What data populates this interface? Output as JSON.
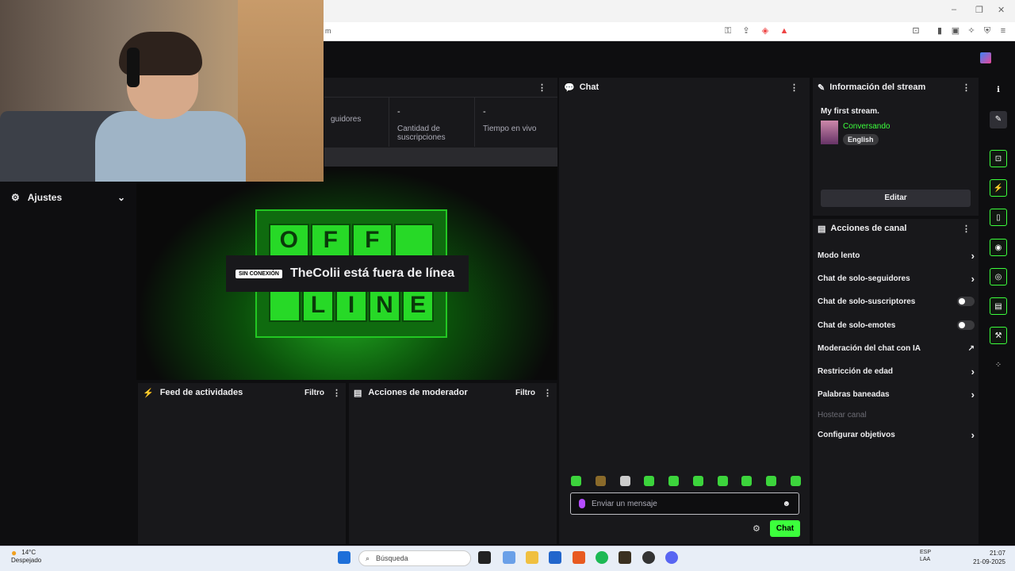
{
  "browser": {
    "url": "m",
    "window_controls": [
      "–",
      "❐",
      "✕"
    ]
  },
  "settings": {
    "label": "Ajustes"
  },
  "stats": {
    "items": [
      {
        "value": "",
        "label": "guidores"
      },
      {
        "value": "-",
        "label": "Cantidad de suscripciones"
      },
      {
        "value": "-",
        "label": "Tiempo en vivo"
      }
    ]
  },
  "player": {
    "offline_badge": "SIN CONEXIÓN",
    "offline_text": "TheColii está fuera de línea",
    "sign_top": [
      "O",
      "F",
      "F",
      ""
    ],
    "sign_bottom": [
      "",
      "L",
      "I",
      "N",
      "E"
    ]
  },
  "feed": {
    "title": "Feed de actividades",
    "filter": "Filtro"
  },
  "mod": {
    "title": "Acciones de moderador",
    "filter": "Filtro"
  },
  "chat": {
    "title": "Chat",
    "input_placeholder": "Enviar un mensaje",
    "send_label": "Chat"
  },
  "stream_info": {
    "title": "Información del stream",
    "stream_title": "My first stream.",
    "category": "Conversando",
    "language": "English",
    "edit_label": "Editar"
  },
  "channel_actions": {
    "title": "Acciones de canal",
    "items": [
      {
        "label": "Modo lento",
        "type": "chevron"
      },
      {
        "label": "Chat de solo-seguidores",
        "type": "chevron"
      },
      {
        "label": "Chat de solo-suscriptores",
        "type": "toggle"
      },
      {
        "label": "Chat de solo-emotes",
        "type": "toggle"
      },
      {
        "label": "Moderación del chat con IA",
        "type": "external"
      },
      {
        "label": "Restricción de edad",
        "type": "chevron"
      },
      {
        "label": "Palabras baneadas",
        "type": "chevron"
      },
      {
        "label": "Hostear canal",
        "type": "disabled"
      },
      {
        "label": "Configurar objetivos",
        "type": "chevron"
      }
    ]
  },
  "taskbar": {
    "temperature": "14°C",
    "weather": "Despejado",
    "search_placeholder": "Búsqueda",
    "keyboard_lang": "ESP",
    "keyboard_region": "LAA",
    "time": "21:07",
    "date": "21-09-2025"
  },
  "colors": {
    "accent": "#3cff3c",
    "background": "#0e0e10",
    "panel": "#18181b"
  }
}
